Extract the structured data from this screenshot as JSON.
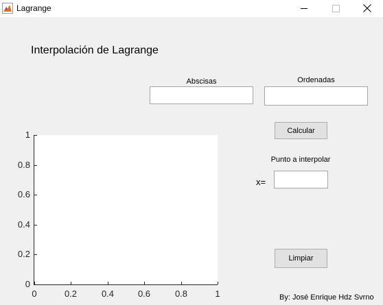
{
  "window": {
    "title": "Lagrange"
  },
  "app": {
    "heading": "Interpolación de Lagrange",
    "abscisas": {
      "label": "Abscisas",
      "value": ""
    },
    "ordenadas": {
      "label": "Ordenadas",
      "value": ""
    },
    "calcular_label": "Calcular",
    "punto": {
      "label": "Punto a interpolar",
      "prefix": "x=",
      "value": ""
    },
    "limpiar_label": "Limpiar",
    "credits": "By: José Enrique Hdz Svrno"
  },
  "chart_data": {
    "type": "line",
    "series": [],
    "xlim": [
      0,
      1
    ],
    "ylim": [
      0,
      1
    ],
    "xticks": [
      "0",
      "0.2",
      "0.4",
      "0.6",
      "0.8",
      "1"
    ],
    "yticks": [
      "0",
      "0.2",
      "0.4",
      "0.6",
      "0.8",
      "1"
    ],
    "grid": false
  }
}
